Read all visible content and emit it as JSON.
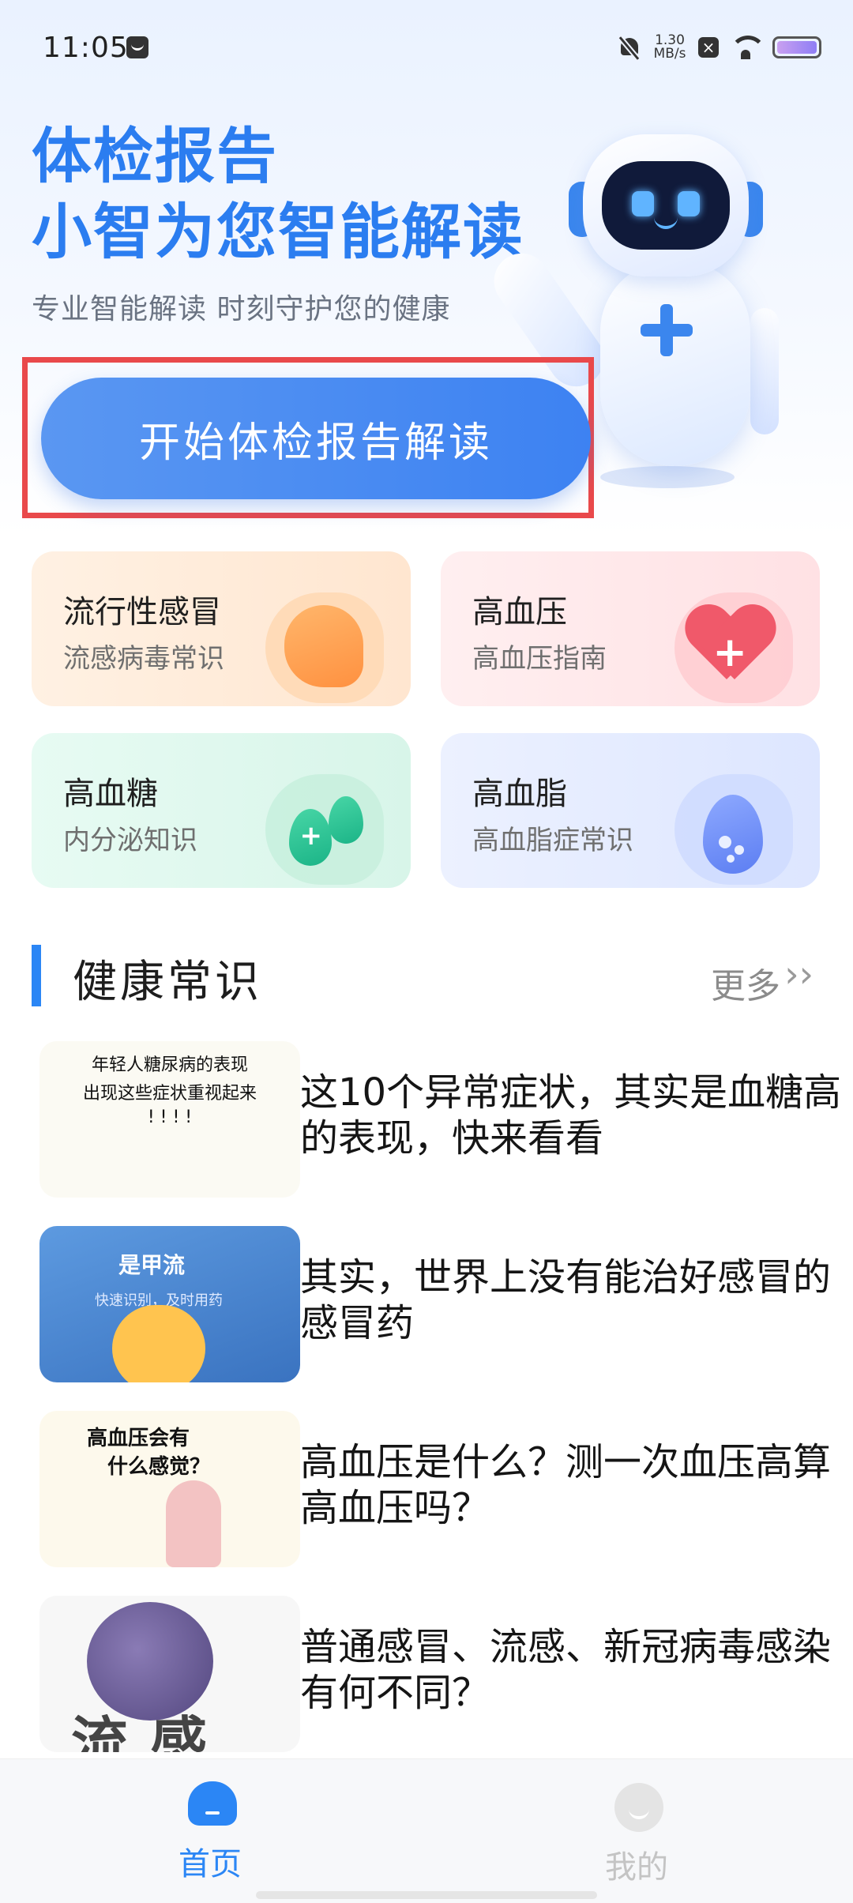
{
  "status_bar": {
    "time": "11:05",
    "net_speed_value": "1.30",
    "net_speed_unit": "MB/s",
    "icons": [
      "message-icon",
      "bell-off-icon",
      "close-badge-icon",
      "wifi-icon",
      "battery-icon"
    ]
  },
  "hero": {
    "title_line1": "体检报告",
    "title_line2": "小智为您智能解读",
    "subtitle": "专业智能解读 时刻守护您的健康",
    "start_button": "开始体检报告解读"
  },
  "cards": [
    {
      "title": "流行性感冒",
      "desc": "流感病毒常识"
    },
    {
      "title": "高血压",
      "desc": "高血压指南"
    },
    {
      "title": "高血糖",
      "desc": "内分泌知识"
    },
    {
      "title": "高血脂",
      "desc": "高血脂症常识"
    }
  ],
  "section": {
    "title": "健康常识",
    "more": "更多",
    "more_arrow": "››"
  },
  "articles": [
    {
      "title": "这10个异常症状，其实是血糖高的表现，快来看看",
      "thumb_lines": [
        "年轻人糖尿病的表现",
        "出现这些症状重视起来",
        "! ! ! !"
      ]
    },
    {
      "title": "其实，世界上没有能治好感冒的感冒药",
      "thumb_lines": [
        "是甲流",
        "快速识别，及时用药"
      ]
    },
    {
      "title": "高血压是什么？测一次血压高算高血压吗？",
      "thumb_lines": [
        "高血压会有",
        "什么感觉？"
      ]
    },
    {
      "title": "普通感冒、流感、新冠病毒感染有何不同？",
      "thumb_lines": [
        "流感"
      ]
    }
  ],
  "bottom_nav": {
    "home": "首页",
    "me": "我的"
  },
  "colors": {
    "accent": "#2b86f5",
    "highlight_frame": "#e9494b"
  }
}
